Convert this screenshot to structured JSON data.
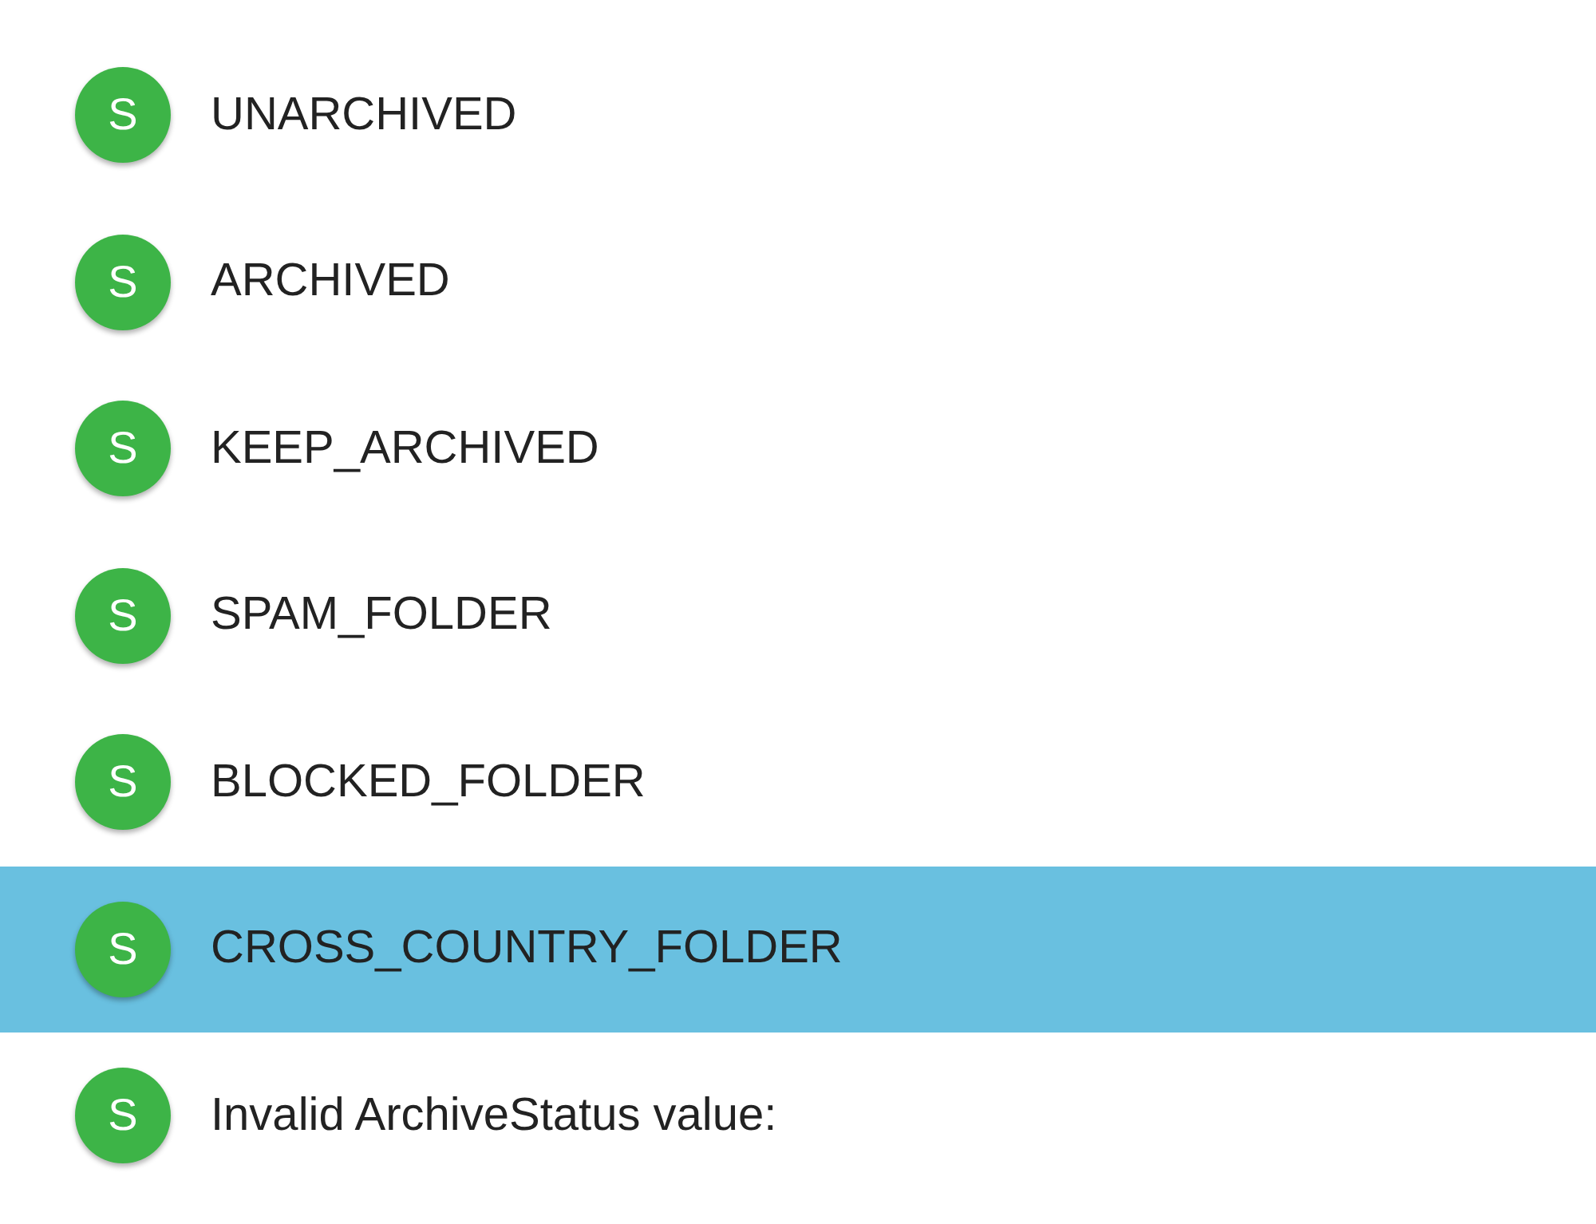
{
  "items": [
    {
      "avatar": "S",
      "label": "UNARCHIVED",
      "selected": false
    },
    {
      "avatar": "S",
      "label": "ARCHIVED",
      "selected": false
    },
    {
      "avatar": "S",
      "label": "KEEP_ARCHIVED",
      "selected": false
    },
    {
      "avatar": "S",
      "label": "SPAM_FOLDER",
      "selected": false
    },
    {
      "avatar": "S",
      "label": "BLOCKED_FOLDER",
      "selected": false
    },
    {
      "avatar": "S",
      "label": "CROSS_COUNTRY_FOLDER",
      "selected": true
    },
    {
      "avatar": "S",
      "label": "Invalid ArchiveStatus value:",
      "selected": false
    }
  ]
}
